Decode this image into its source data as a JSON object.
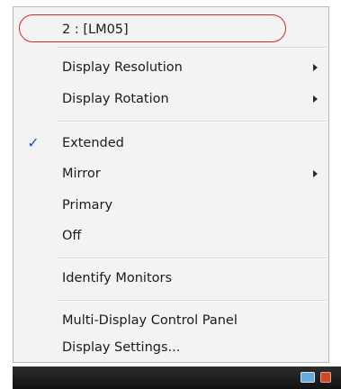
{
  "menu": {
    "monitor": {
      "label": "2 : [LM05]"
    },
    "resolution": {
      "label": "Display Resolution"
    },
    "rotation": {
      "label": "Display Rotation"
    },
    "extended": {
      "label": "Extended",
      "checked": true
    },
    "mirror": {
      "label": "Mirror"
    },
    "primary": {
      "label": "Primary"
    },
    "off": {
      "label": "Off"
    },
    "identify": {
      "label": "Identify Monitors"
    },
    "control_panel": {
      "label": "Multi-Display Control Panel"
    },
    "display_settings": {
      "label": "Display Settings..."
    },
    "check_glyph": "✓"
  },
  "annotation": {
    "color": "#d02a2a"
  },
  "taskbar": {
    "icons": [
      "monitor-tray-icon",
      "alert-tray-icon"
    ]
  }
}
